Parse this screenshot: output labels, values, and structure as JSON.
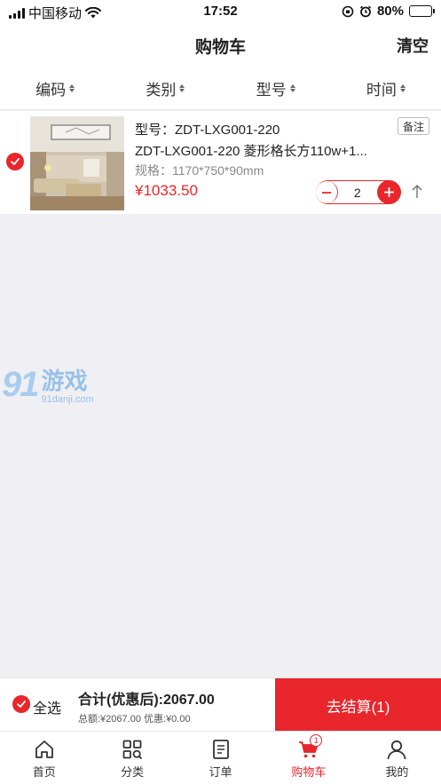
{
  "status_bar": {
    "carrier": "中国移动",
    "time": "17:52",
    "battery": "80%",
    "battery_level": 0.8
  },
  "nav": {
    "title": "购物车",
    "clear_label": "清空"
  },
  "sort": [
    {
      "label": "编码"
    },
    {
      "label": "类别"
    },
    {
      "label": "型号"
    },
    {
      "label": "时间"
    }
  ],
  "item": {
    "model": "型号：ZDT-LXG001-220",
    "name": "ZDT-LXG001-220 菱形格长方110w+1...",
    "spec": "规格：1170*750*90mm",
    "price": "¥1033.50",
    "remark_label": "备注",
    "quantity": "2",
    "checked": true
  },
  "watermark": {
    "logo": "91",
    "text": "游戏",
    "url": "91danji.com"
  },
  "checkout": {
    "select_all_label": "全选",
    "total": "合计(优惠后):2067.00",
    "sub": "总额:¥2067.00 优惠:¥0.00",
    "button": "去结算(1)"
  },
  "tabs": [
    {
      "label": "首页",
      "icon": "home-icon"
    },
    {
      "label": "分类",
      "icon": "category-icon"
    },
    {
      "label": "订单",
      "icon": "order-icon"
    },
    {
      "label": "购物车",
      "icon": "cart-icon",
      "badge": "1",
      "active": true
    },
    {
      "label": "我的",
      "icon": "user-icon"
    }
  ],
  "colors": {
    "accent": "#e8262b",
    "background": "#efeff4"
  }
}
